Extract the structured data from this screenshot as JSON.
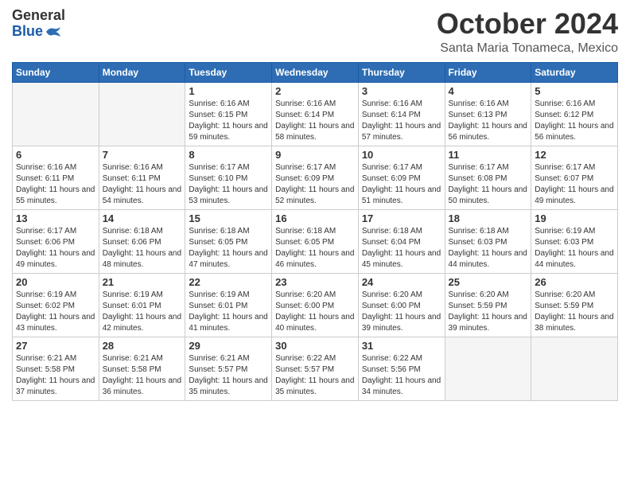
{
  "header": {
    "logo_general": "General",
    "logo_blue": "Blue",
    "month": "October 2024",
    "location": "Santa Maria Tonameca, Mexico"
  },
  "days_of_week": [
    "Sunday",
    "Monday",
    "Tuesday",
    "Wednesday",
    "Thursday",
    "Friday",
    "Saturday"
  ],
  "weeks": [
    [
      {
        "day": "",
        "empty": true
      },
      {
        "day": "",
        "empty": true
      },
      {
        "day": "1",
        "sunrise": "6:16 AM",
        "sunset": "6:15 PM",
        "daylight": "11 hours and 59 minutes."
      },
      {
        "day": "2",
        "sunrise": "6:16 AM",
        "sunset": "6:14 PM",
        "daylight": "11 hours and 58 minutes."
      },
      {
        "day": "3",
        "sunrise": "6:16 AM",
        "sunset": "6:14 PM",
        "daylight": "11 hours and 57 minutes."
      },
      {
        "day": "4",
        "sunrise": "6:16 AM",
        "sunset": "6:13 PM",
        "daylight": "11 hours and 56 minutes."
      },
      {
        "day": "5",
        "sunrise": "6:16 AM",
        "sunset": "6:12 PM",
        "daylight": "11 hours and 56 minutes."
      }
    ],
    [
      {
        "day": "6",
        "sunrise": "6:16 AM",
        "sunset": "6:11 PM",
        "daylight": "11 hours and 55 minutes."
      },
      {
        "day": "7",
        "sunrise": "6:16 AM",
        "sunset": "6:11 PM",
        "daylight": "11 hours and 54 minutes."
      },
      {
        "day": "8",
        "sunrise": "6:17 AM",
        "sunset": "6:10 PM",
        "daylight": "11 hours and 53 minutes."
      },
      {
        "day": "9",
        "sunrise": "6:17 AM",
        "sunset": "6:09 PM",
        "daylight": "11 hours and 52 minutes."
      },
      {
        "day": "10",
        "sunrise": "6:17 AM",
        "sunset": "6:09 PM",
        "daylight": "11 hours and 51 minutes."
      },
      {
        "day": "11",
        "sunrise": "6:17 AM",
        "sunset": "6:08 PM",
        "daylight": "11 hours and 50 minutes."
      },
      {
        "day": "12",
        "sunrise": "6:17 AM",
        "sunset": "6:07 PM",
        "daylight": "11 hours and 49 minutes."
      }
    ],
    [
      {
        "day": "13",
        "sunrise": "6:17 AM",
        "sunset": "6:06 PM",
        "daylight": "11 hours and 49 minutes."
      },
      {
        "day": "14",
        "sunrise": "6:18 AM",
        "sunset": "6:06 PM",
        "daylight": "11 hours and 48 minutes."
      },
      {
        "day": "15",
        "sunrise": "6:18 AM",
        "sunset": "6:05 PM",
        "daylight": "11 hours and 47 minutes."
      },
      {
        "day": "16",
        "sunrise": "6:18 AM",
        "sunset": "6:05 PM",
        "daylight": "11 hours and 46 minutes."
      },
      {
        "day": "17",
        "sunrise": "6:18 AM",
        "sunset": "6:04 PM",
        "daylight": "11 hours and 45 minutes."
      },
      {
        "day": "18",
        "sunrise": "6:18 AM",
        "sunset": "6:03 PM",
        "daylight": "11 hours and 44 minutes."
      },
      {
        "day": "19",
        "sunrise": "6:19 AM",
        "sunset": "6:03 PM",
        "daylight": "11 hours and 44 minutes."
      }
    ],
    [
      {
        "day": "20",
        "sunrise": "6:19 AM",
        "sunset": "6:02 PM",
        "daylight": "11 hours and 43 minutes."
      },
      {
        "day": "21",
        "sunrise": "6:19 AM",
        "sunset": "6:01 PM",
        "daylight": "11 hours and 42 minutes."
      },
      {
        "day": "22",
        "sunrise": "6:19 AM",
        "sunset": "6:01 PM",
        "daylight": "11 hours and 41 minutes."
      },
      {
        "day": "23",
        "sunrise": "6:20 AM",
        "sunset": "6:00 PM",
        "daylight": "11 hours and 40 minutes."
      },
      {
        "day": "24",
        "sunrise": "6:20 AM",
        "sunset": "6:00 PM",
        "daylight": "11 hours and 39 minutes."
      },
      {
        "day": "25",
        "sunrise": "6:20 AM",
        "sunset": "5:59 PM",
        "daylight": "11 hours and 39 minutes."
      },
      {
        "day": "26",
        "sunrise": "6:20 AM",
        "sunset": "5:59 PM",
        "daylight": "11 hours and 38 minutes."
      }
    ],
    [
      {
        "day": "27",
        "sunrise": "6:21 AM",
        "sunset": "5:58 PM",
        "daylight": "11 hours and 37 minutes."
      },
      {
        "day": "28",
        "sunrise": "6:21 AM",
        "sunset": "5:58 PM",
        "daylight": "11 hours and 36 minutes."
      },
      {
        "day": "29",
        "sunrise": "6:21 AM",
        "sunset": "5:57 PM",
        "daylight": "11 hours and 35 minutes."
      },
      {
        "day": "30",
        "sunrise": "6:22 AM",
        "sunset": "5:57 PM",
        "daylight": "11 hours and 35 minutes."
      },
      {
        "day": "31",
        "sunrise": "6:22 AM",
        "sunset": "5:56 PM",
        "daylight": "11 hours and 34 minutes."
      },
      {
        "day": "",
        "empty": true
      },
      {
        "day": "",
        "empty": true
      }
    ]
  ],
  "labels": {
    "sunrise": "Sunrise:",
    "sunset": "Sunset:",
    "daylight": "Daylight:"
  }
}
